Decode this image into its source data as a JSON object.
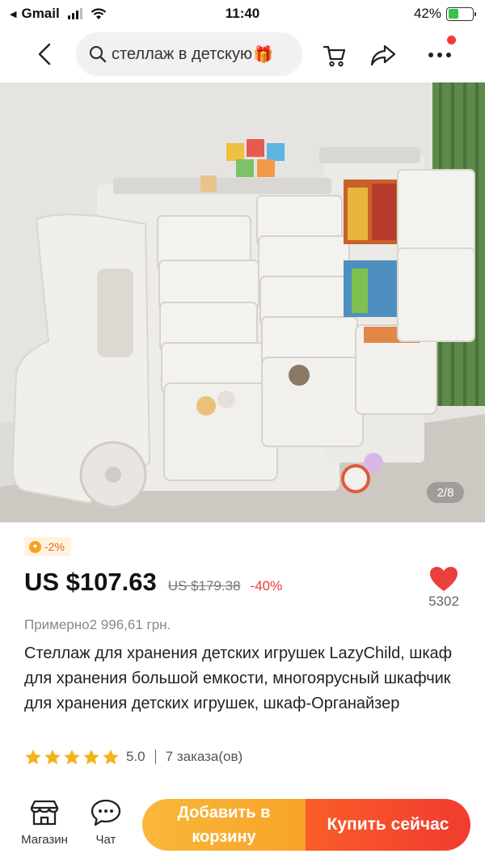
{
  "status_bar": {
    "carrier": "Gmail",
    "time": "11:40",
    "battery": "42%",
    "battery_level": 0.42
  },
  "nav": {
    "search_query": "стеллаж в детскую",
    "icons": [
      "back-arrow-icon",
      "search-icon",
      "gift-icon",
      "cart-icon",
      "share-icon",
      "more-icon"
    ]
  },
  "gallery": {
    "counter": "2/8"
  },
  "product": {
    "discount_badge": "-2%",
    "price": "US $107.63",
    "old_price": "US $179.38",
    "discount_pct": "-40%",
    "wishlist_count": "5302",
    "approx_price": "Примерно2 996,61 грн.",
    "title": "Стеллаж для хранения детских игрушек LazyChild, шкаф для хранения большой емкости, многоярусный шкафчик для хранения детских игрушек, шкаф-Органайзер",
    "rating": "5.0",
    "stars": 5,
    "orders": "7 заказа(ов)"
  },
  "bottom_bar": {
    "store_label": "Магазин",
    "chat_label": "Чат",
    "add_to_cart": "Добавить в корзину",
    "buy_now": "Купить сейчас"
  },
  "colors": {
    "accent_red": "#f13b2f",
    "accent_orange": "#f7a428",
    "heart": "#e9403e",
    "star": "#f5b31a"
  }
}
